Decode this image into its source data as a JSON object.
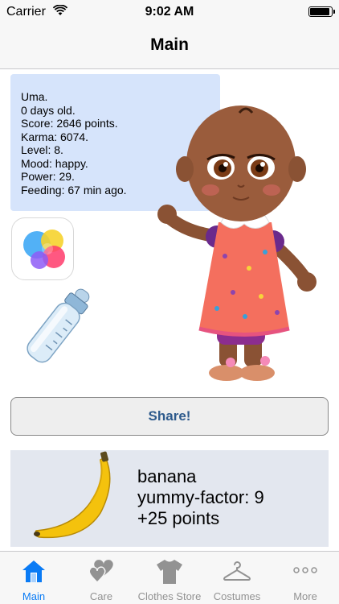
{
  "status_bar": {
    "carrier": "Carrier",
    "time": "9:02 AM"
  },
  "nav": {
    "title": "Main"
  },
  "info": {
    "lines": [
      "Uma.",
      "0 days old.",
      "Score: 2646 points.",
      "Karma: 6074.",
      "Level: 8.",
      "Mood: happy.",
      "Power: 29.",
      "Feeding: 67 min ago."
    ]
  },
  "share": {
    "label": "Share!"
  },
  "food": {
    "name": "banana",
    "yummy": "yummy-factor: 9",
    "points": "+25 points"
  },
  "tabs": [
    {
      "label": "Main",
      "icon": "house-icon",
      "active": true
    },
    {
      "label": "Care",
      "icon": "hearts-icon",
      "active": false
    },
    {
      "label": "Clothes Store",
      "icon": "shirt-icon",
      "active": false
    },
    {
      "label": "Costumes",
      "icon": "hanger-icon",
      "active": false
    },
    {
      "label": "More",
      "icon": "more-dots-icon",
      "active": false
    }
  ],
  "colors": {
    "accent": "#0a7bf5",
    "tab_inactive": "#929292",
    "info_bg": "#d6e4fb",
    "share_text": "#2d5a8c",
    "food_bg": "#e3e7ef"
  }
}
